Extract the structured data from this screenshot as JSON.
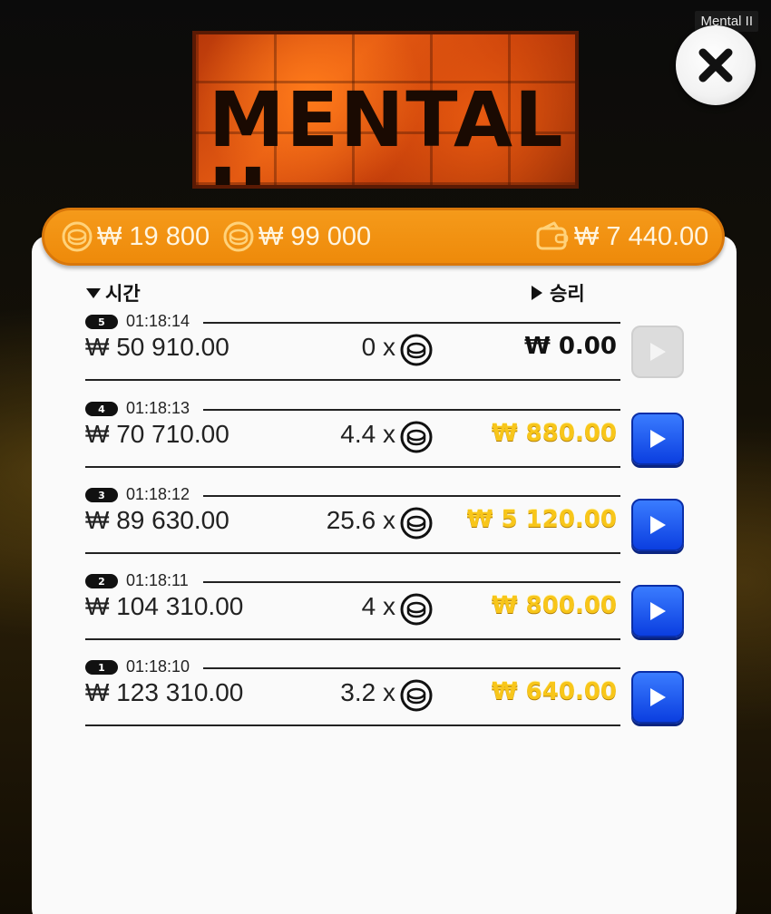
{
  "window": {
    "title": "Mental II"
  },
  "logo": {
    "text": "MENTAL II"
  },
  "balances": {
    "bet_amount": "₩ 19 800",
    "bonus_amount": "₩ 99 000",
    "wallet_amount": "₩ 7 440.00"
  },
  "columns": {
    "time": "시간",
    "win": "승리"
  },
  "rounds": [
    {
      "number": "5",
      "time": "01:18:14",
      "bet": "₩ 50 910.00",
      "multiplier": "0 x",
      "win": "₩ 0.00",
      "replay_enabled": false
    },
    {
      "number": "4",
      "time": "01:18:13",
      "bet": "₩ 70 710.00",
      "multiplier": "4.4 x",
      "win": "₩ 880.00",
      "replay_enabled": true
    },
    {
      "number": "3",
      "time": "01:18:12",
      "bet": "₩ 89 630.00",
      "multiplier": "25.6 x",
      "win": "₩ 5 120.00",
      "replay_enabled": true
    },
    {
      "number": "2",
      "time": "01:18:11",
      "bet": "₩ 104 310.00",
      "multiplier": "4 x",
      "win": "₩ 800.00",
      "replay_enabled": true
    },
    {
      "number": "1",
      "time": "01:18:10",
      "bet": "₩ 123 310.00",
      "multiplier": "3.2 x",
      "win": "₩ 640.00",
      "replay_enabled": true
    }
  ],
  "colors": {
    "accent_orange": "#ee8a0a",
    "win_gold": "#f8c61a",
    "replay_blue": "#1a55f0"
  }
}
